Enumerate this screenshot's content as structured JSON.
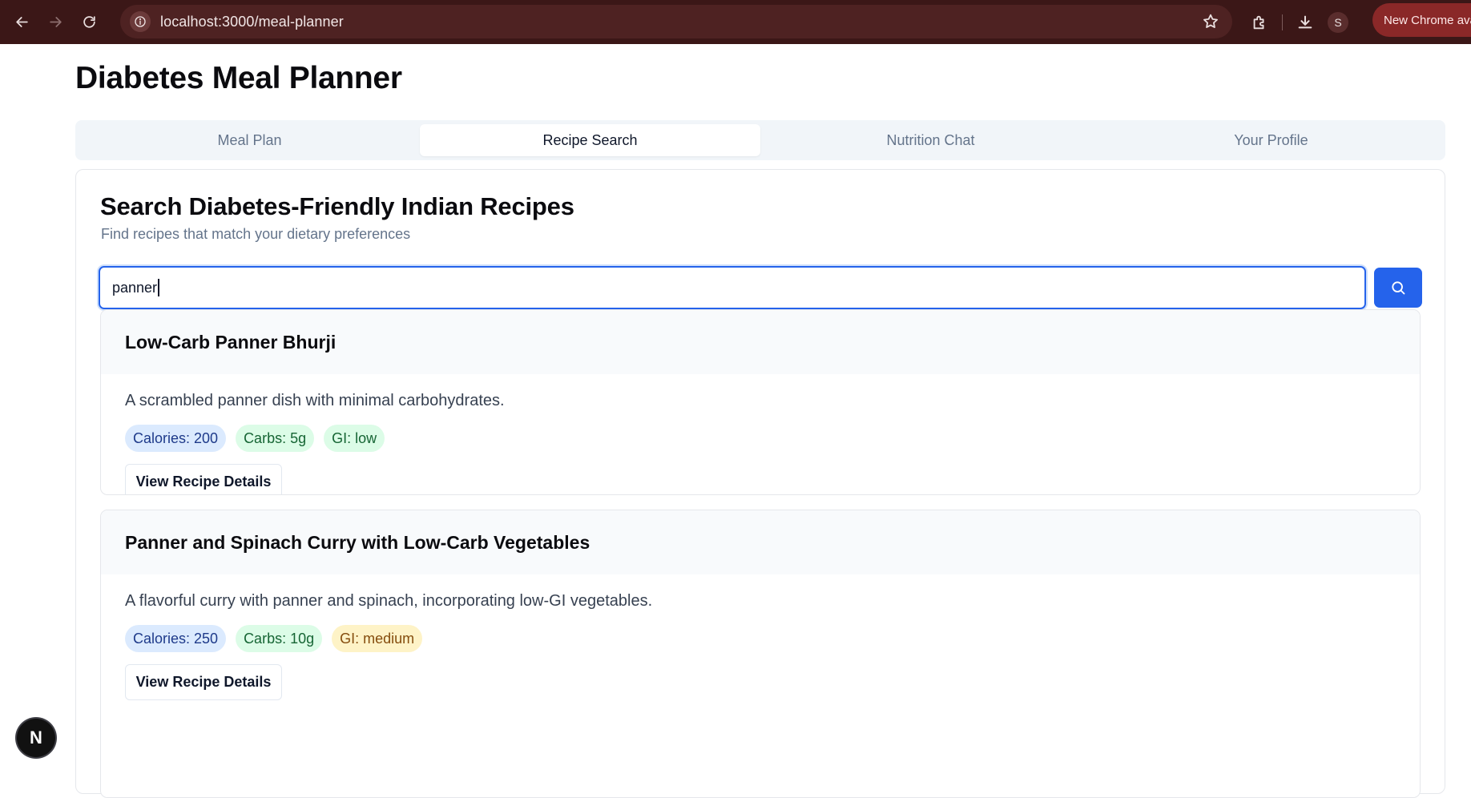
{
  "browser": {
    "url": "localhost:3000/meal-planner",
    "profile_initial": "S",
    "update_label": "New Chrome ava"
  },
  "page": {
    "title": "Diabetes Meal Planner"
  },
  "tabs": [
    {
      "label": "Meal Plan",
      "active": false
    },
    {
      "label": "Recipe Search",
      "active": true
    },
    {
      "label": "Nutrition Chat",
      "active": false
    },
    {
      "label": "Your Profile",
      "active": false
    }
  ],
  "search_card": {
    "title": "Search Diabetes-Friendly Indian Recipes",
    "subtitle": "Find recipes that match your dietary preferences",
    "query": "panner"
  },
  "recipes": [
    {
      "name": "Low-Carb Panner Bhurji",
      "description": "A scrambled panner dish with minimal carbohydrates.",
      "calories": "Calories: 200",
      "carbs": "Carbs: 5g",
      "gi": "GI: low",
      "button": "View Recipe Details"
    },
    {
      "name": "Panner and Spinach Curry with Low-Carb Vegetables",
      "description": "A flavorful curry with panner and spinach, incorporating low-GI vegetables.",
      "calories": "Calories: 250",
      "carbs": "Carbs: 10g",
      "gi": "GI: medium",
      "button": "View Recipe Details"
    }
  ],
  "dev_badge": {
    "label": "N"
  },
  "icons": [
    "back-icon",
    "forward-icon",
    "reload-icon",
    "site-info-icon",
    "bookmark-star-icon",
    "extensions-icon",
    "download-icon",
    "search-icon"
  ],
  "colors": {
    "primary": "#2563eb",
    "chrome_bg": "#3b1717",
    "calories_badge": "#dbeafe",
    "carbs_badge": "#dcfce7",
    "gi_medium_badge": "#fef3c7"
  }
}
